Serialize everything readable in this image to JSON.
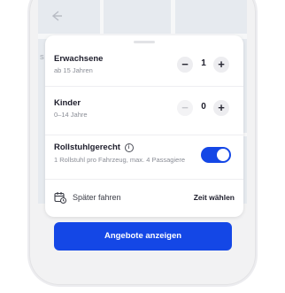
{
  "header": {
    "back_icon": "arrow-left-icon"
  },
  "map": {
    "label_left": "S"
  },
  "passengers": {
    "adults": {
      "title": "Erwachsene",
      "subtitle": "ab 15 Jahren",
      "value": "1",
      "minus": "−",
      "plus": "+"
    },
    "children": {
      "title": "Kinder",
      "subtitle": "0–14 Jahre",
      "value": "0",
      "minus": "−",
      "plus": "+"
    }
  },
  "wheelchair": {
    "title": "Rollstuhlgerecht",
    "info_glyph": "i",
    "subtitle": "1 Rollstuhl pro Fahrzeug, max. 4 Passagiere",
    "enabled": true
  },
  "schedule": {
    "label": "Später fahren",
    "action": "Zeit wählen",
    "icon": "calendar-clock-icon"
  },
  "cta": {
    "label": "Angebote anzeigen"
  },
  "colors": {
    "accent": "#1447e6",
    "text": "#1d1d2b",
    "muted": "#8a8d96"
  }
}
